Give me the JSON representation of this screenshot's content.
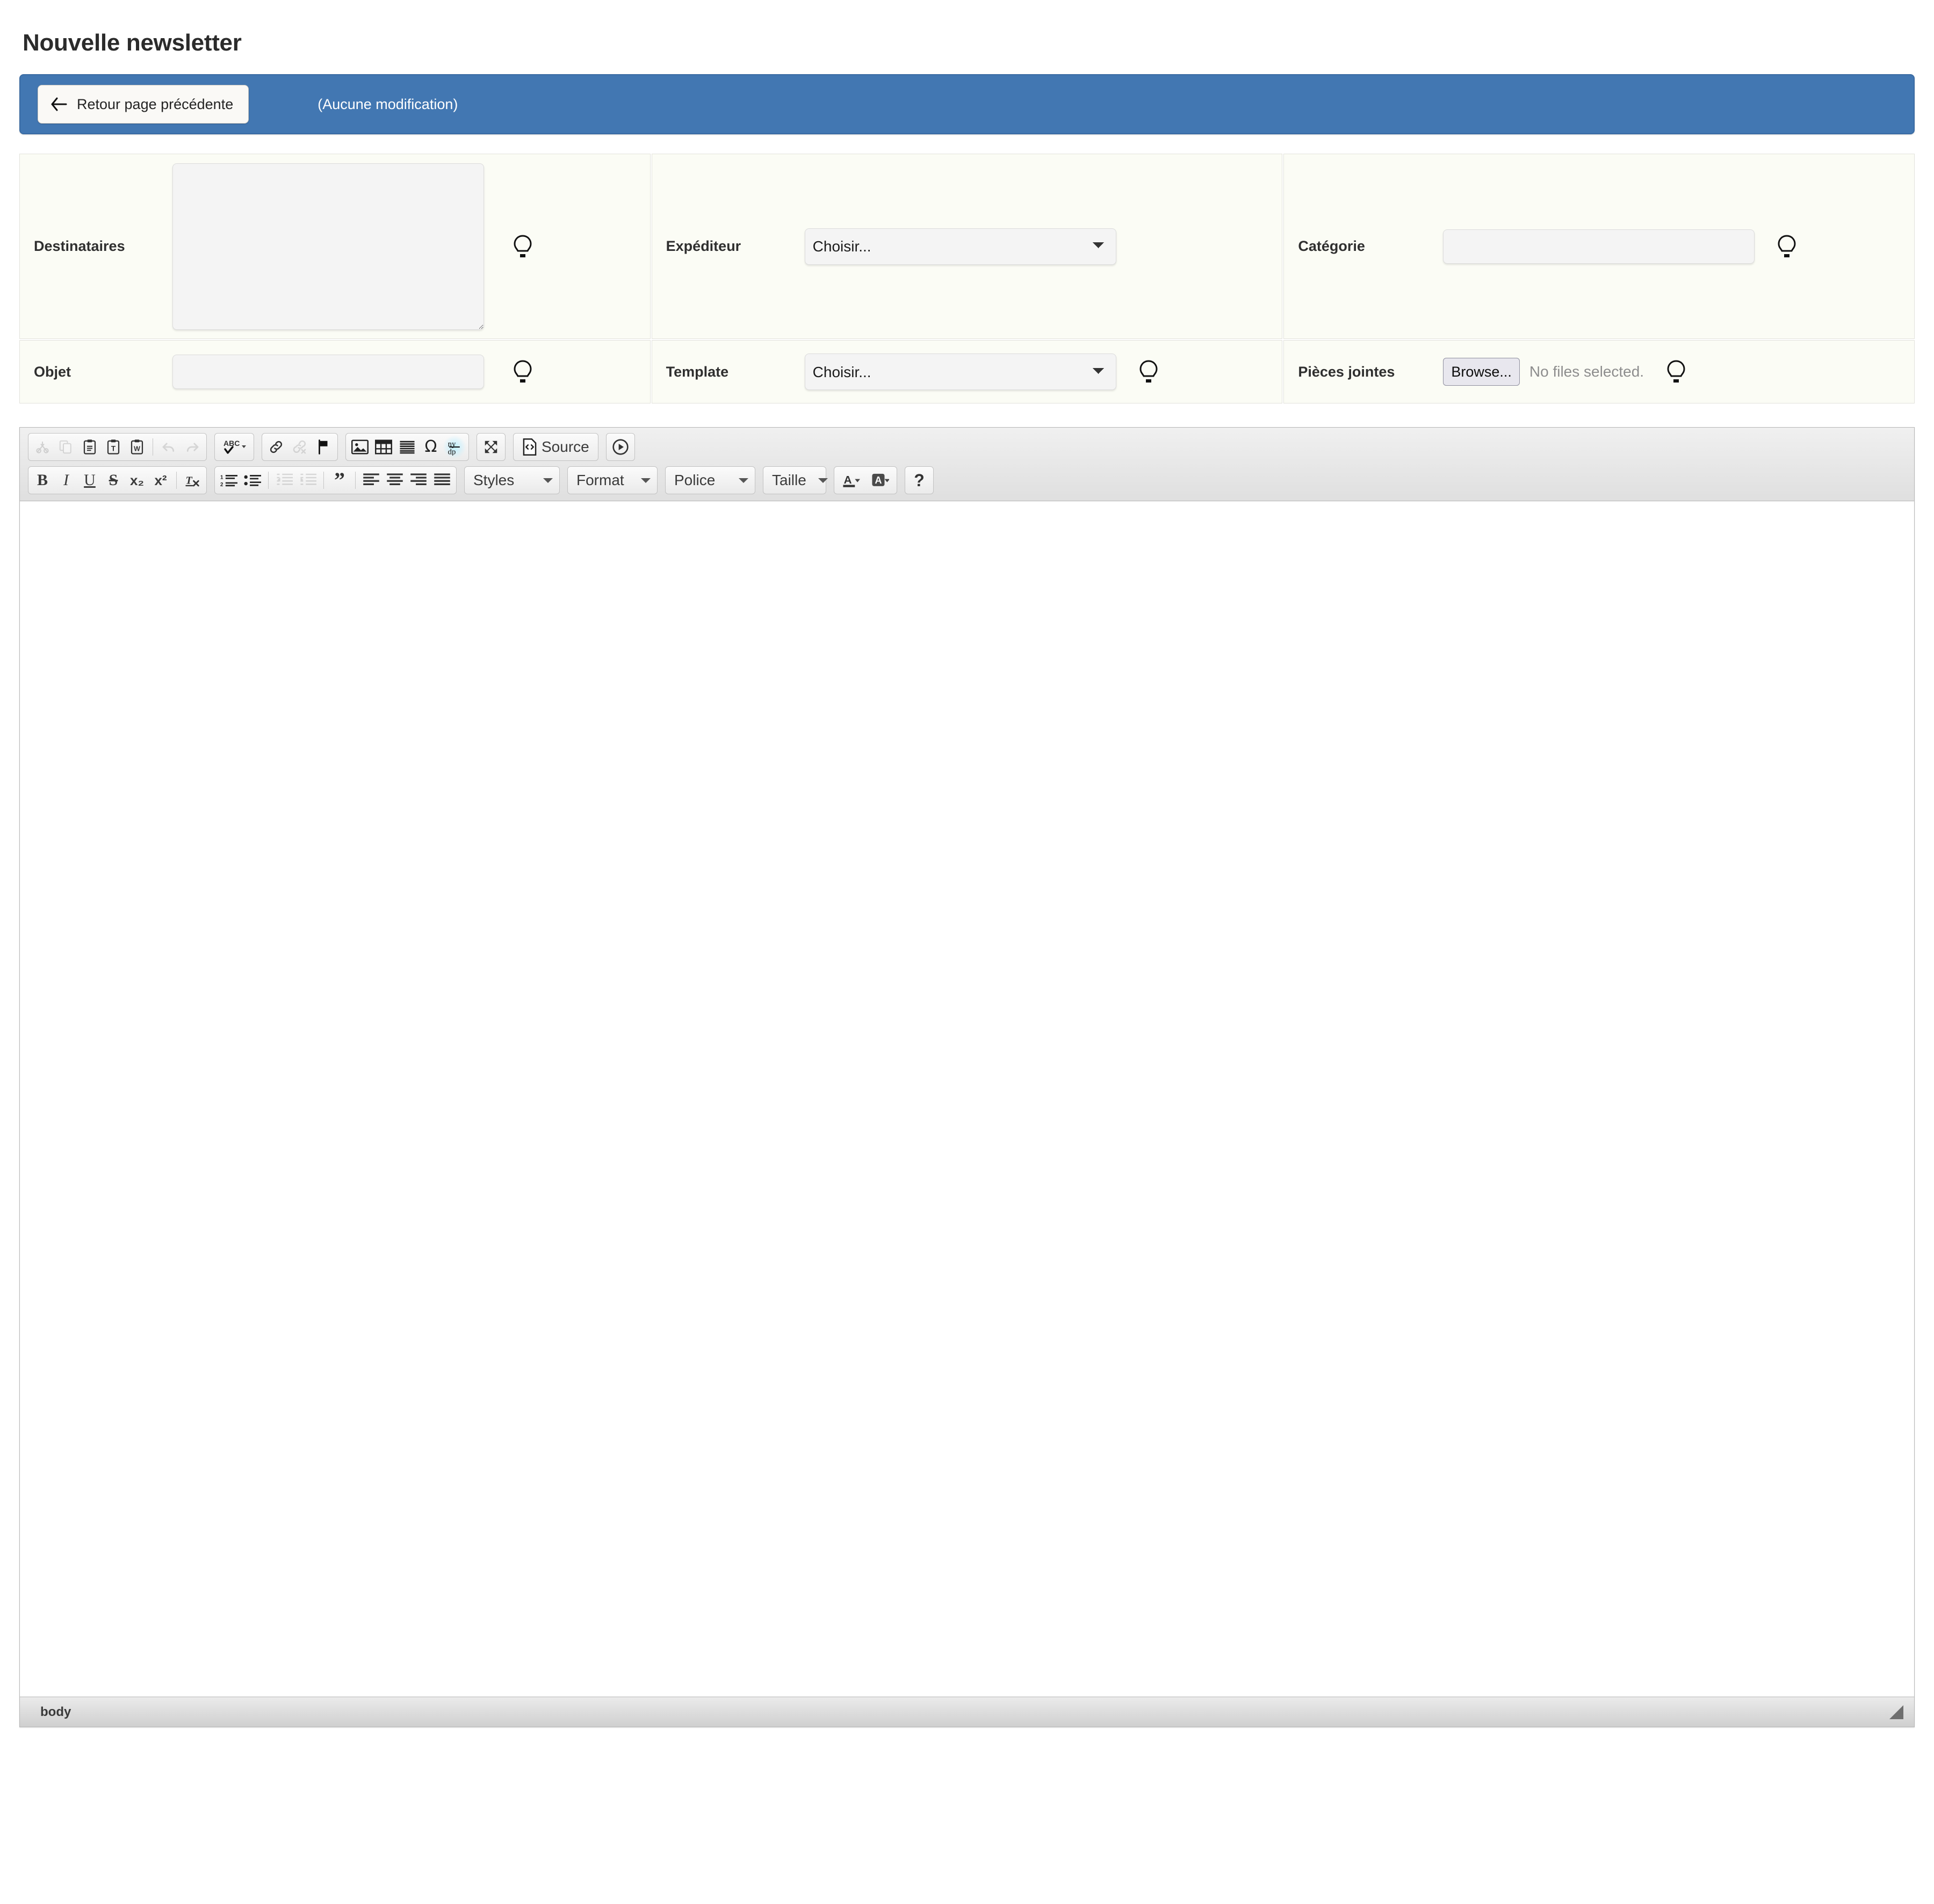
{
  "page": {
    "title": "Nouvelle newsletter"
  },
  "actionbar": {
    "back_label": "Retour page précédente",
    "back_icon": "arrow-left-icon",
    "status": "(Aucune modification)",
    "accent_color": "#4277b2"
  },
  "form": {
    "hint_icon": "lightbulb-icon",
    "fields": {
      "destinataires": {
        "label": "Destinataires",
        "value": "",
        "placeholder": ""
      },
      "objet": {
        "label": "Objet",
        "value": "",
        "placeholder": ""
      },
      "expediteur": {
        "label": "Expéditeur",
        "selected": "Choisir...",
        "options": [
          "Choisir..."
        ]
      },
      "template": {
        "label": "Template",
        "selected": "Choisir...",
        "options": [
          "Choisir..."
        ]
      },
      "categorie": {
        "label": "Catégorie",
        "value": "",
        "placeholder": ""
      },
      "pieces_jointes": {
        "label": "Pièces jointes",
        "browse_label": "Browse...",
        "status": "No files selected."
      }
    }
  },
  "editor": {
    "toolbar_row1": [
      {
        "group": "clipboard",
        "items": [
          {
            "name": "cut-icon",
            "title": "Couper",
            "disabled": true
          },
          {
            "name": "copy-icon",
            "title": "Copier",
            "disabled": true
          },
          {
            "name": "paste-icon",
            "title": "Coller",
            "disabled": false
          },
          {
            "name": "paste-text-icon",
            "title": "Coller comme texte",
            "disabled": false
          },
          {
            "name": "paste-word-icon",
            "title": "Coller depuis Word",
            "disabled": false
          },
          {
            "name": "separator",
            "title": "",
            "disabled": false
          },
          {
            "name": "undo-icon",
            "title": "Annuler",
            "disabled": true
          },
          {
            "name": "redo-icon",
            "title": "Rétablir",
            "disabled": true
          }
        ]
      },
      {
        "group": "spell",
        "items": [
          {
            "name": "spellcheck-icon",
            "label": "ABC",
            "title": "Vérifier l'orthographe",
            "disabled": false
          }
        ]
      },
      {
        "group": "links",
        "items": [
          {
            "name": "link-icon",
            "title": "Lien",
            "disabled": false
          },
          {
            "name": "unlink-icon",
            "title": "Délier",
            "disabled": true
          },
          {
            "name": "anchor-flag-icon",
            "title": "Ancre",
            "disabled": false
          }
        ]
      },
      {
        "group": "insert",
        "items": [
          {
            "name": "image-icon",
            "title": "Image",
            "disabled": false
          },
          {
            "name": "table-icon",
            "title": "Tableau",
            "disabled": false
          },
          {
            "name": "horizontal-rule-icon",
            "title": "Ligne horizontale",
            "disabled": false
          },
          {
            "name": "special-char-icon",
            "label": "Ω",
            "title": "Caractères spéciaux",
            "disabled": false
          },
          {
            "name": "page-break-icon",
            "title": "Saut de page",
            "disabled": false
          }
        ]
      },
      {
        "group": "view",
        "items": [
          {
            "name": "maximize-icon",
            "title": "Agrandir",
            "disabled": false
          }
        ]
      },
      {
        "group": "source",
        "items": [
          {
            "name": "source-icon",
            "label": "Source",
            "title": "Source",
            "disabled": false
          }
        ]
      },
      {
        "group": "media",
        "items": [
          {
            "name": "play-media-icon",
            "title": "Média",
            "disabled": false
          }
        ]
      }
    ],
    "toolbar_row2": [
      {
        "group": "basicstyles",
        "items": [
          {
            "name": "bold-icon",
            "label": "B",
            "title": "Gras",
            "disabled": false
          },
          {
            "name": "italic-icon",
            "label": "I",
            "title": "Italique",
            "disabled": false
          },
          {
            "name": "underline-icon",
            "label": "U",
            "title": "Souligné",
            "disabled": false
          },
          {
            "name": "strikethrough-icon",
            "label": "S",
            "title": "Barré",
            "disabled": false
          },
          {
            "name": "subscript-icon",
            "label": "x₂",
            "title": "Indice",
            "disabled": false
          },
          {
            "name": "superscript-icon",
            "label": "x²",
            "title": "Exposant",
            "disabled": false
          },
          {
            "name": "separator",
            "label": "",
            "title": "",
            "disabled": false
          },
          {
            "name": "remove-format-icon",
            "label": "Tx",
            "title": "Supprimer le format",
            "disabled": false
          }
        ]
      },
      {
        "group": "paragraph",
        "items": [
          {
            "name": "numbered-list-icon",
            "title": "Liste numérotée",
            "disabled": false
          },
          {
            "name": "bulleted-list-icon",
            "title": "Liste à puces",
            "disabled": false
          },
          {
            "name": "separator",
            "title": "",
            "disabled": false
          },
          {
            "name": "outdent-icon",
            "title": "Diminuer le retrait",
            "disabled": true
          },
          {
            "name": "indent-icon",
            "title": "Augmenter le retrait",
            "disabled": true
          },
          {
            "name": "separator2",
            "title": "",
            "disabled": false
          },
          {
            "name": "blockquote-icon",
            "label": "”",
            "title": "Citation",
            "disabled": false
          },
          {
            "name": "separator3",
            "title": "",
            "disabled": false
          },
          {
            "name": "align-left-icon",
            "title": "Aligner à gauche",
            "disabled": false
          },
          {
            "name": "align-center-icon",
            "title": "Centrer",
            "disabled": false
          },
          {
            "name": "align-right-icon",
            "title": "Aligner à droite",
            "disabled": false
          },
          {
            "name": "align-justify-icon",
            "title": "Justifier",
            "disabled": false
          }
        ]
      }
    ],
    "dropdowns": {
      "styles": "Styles",
      "format": "Format",
      "police": "Police",
      "taille": "Taille"
    },
    "colors": {
      "text_color_icon": "text-color-icon",
      "bg_color_icon": "background-color-icon"
    },
    "help": {
      "label": "?",
      "name": "help-icon"
    },
    "content": "",
    "status_path": "body",
    "resize_grip": "resize-grip-icon"
  }
}
